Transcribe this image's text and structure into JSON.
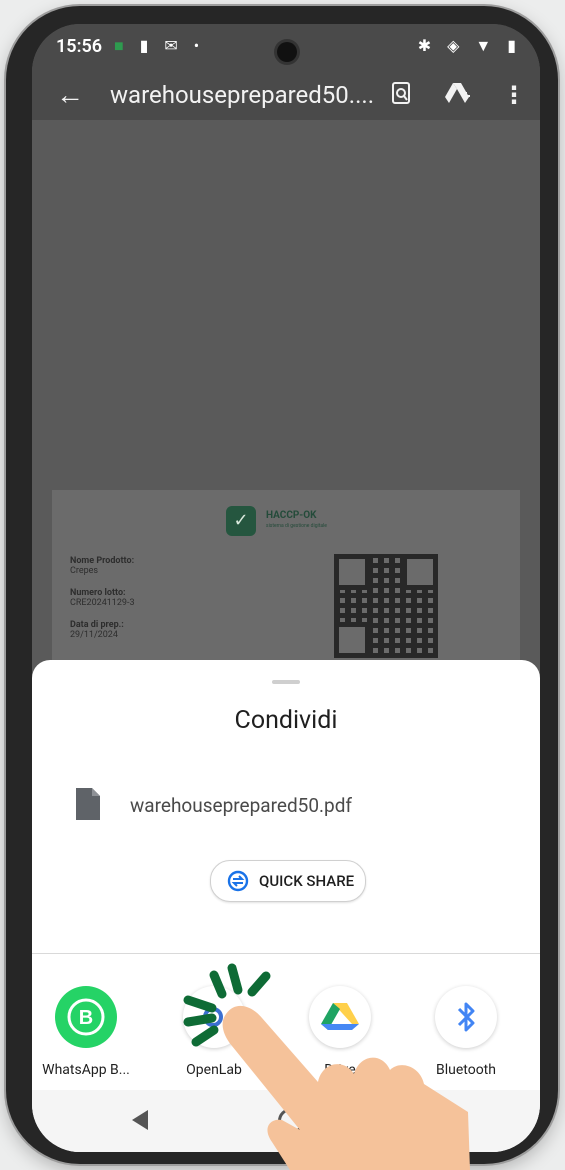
{
  "status_bar": {
    "time": "15:56"
  },
  "app_bar": {
    "title": "warehouseprepared50...."
  },
  "document": {
    "brand": "HACCP-OK",
    "brand_sub": "sistema di gestione digitale",
    "fields": [
      {
        "label": "Nome Prodotto:",
        "value": "Crepes"
      },
      {
        "label": "Numero lotto:",
        "value": "CRE20241129-3"
      },
      {
        "label": "Data di prep.:",
        "value": "29/11/2024"
      }
    ]
  },
  "share_sheet": {
    "title": "Condividi",
    "file_name": "warehouseprepared50.pdf",
    "quick_share_label": "QUICK SHARE",
    "apps": [
      {
        "label": "WhatsApp B...",
        "icon": "whatsapp-business-icon"
      },
      {
        "label": "OpenLab",
        "icon": "openlab-icon"
      },
      {
        "label": "Drive",
        "icon": "google-drive-icon"
      },
      {
        "label": "Bluetooth",
        "icon": "bluetooth-icon"
      }
    ]
  },
  "colors": {
    "whatsapp": "#25D366",
    "drive_green": "#1FA463",
    "drive_yellow": "#FFD04B",
    "drive_blue": "#4688F4",
    "bluetooth": "#4285F4",
    "tap_marks": "#0E6B35",
    "hand": "#F5C29A"
  }
}
